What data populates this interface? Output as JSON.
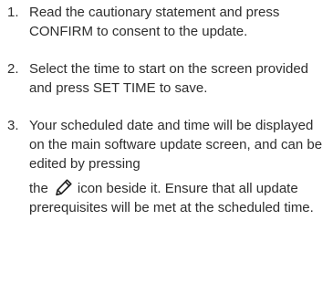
{
  "steps": [
    {
      "number": "1.",
      "text": "Read the cautionary statement and press CONFIRM to consent to the update."
    },
    {
      "number": "2.",
      "text": "Select the time to start on the screen provided and press SET TIME to save."
    },
    {
      "number": "3.",
      "text_before_icon": "Your scheduled date and time will be displayed on the main software update screen, and can be edited by pressing",
      "text_the": "the",
      "icon": "pencil-edit-icon",
      "text_after_icon": "icon beside it. Ensure that all update prerequisites will be met at the scheduled time."
    }
  ]
}
